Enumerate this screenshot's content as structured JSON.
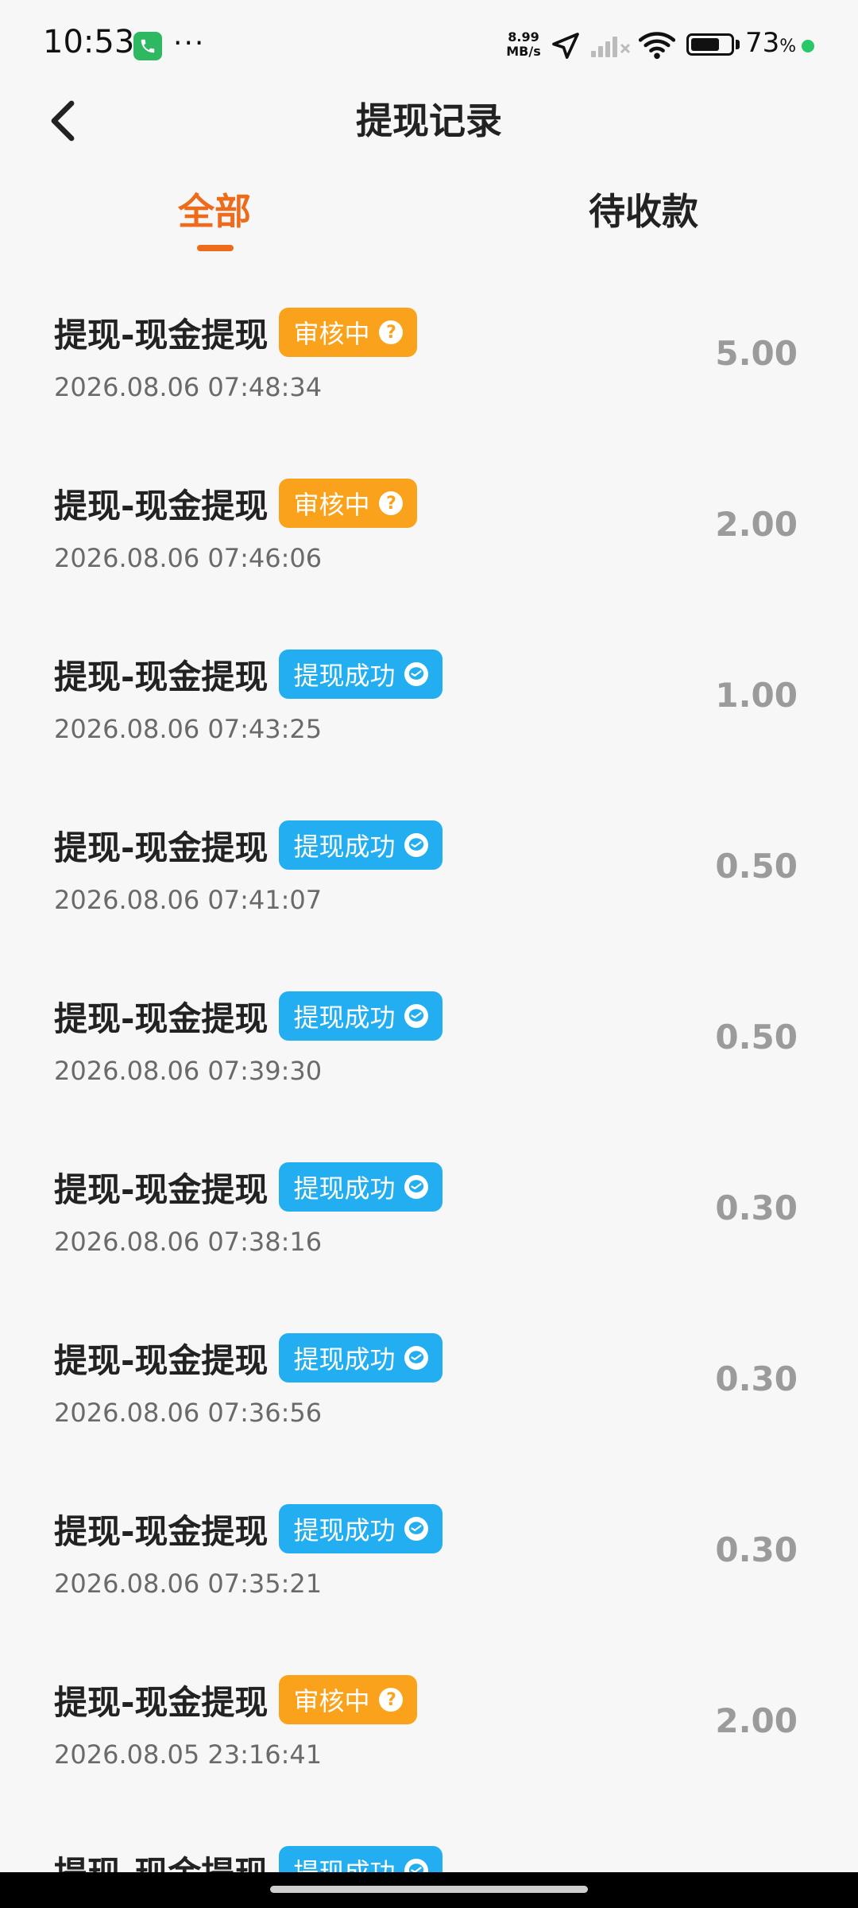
{
  "status_bar": {
    "time": "10:53",
    "dots": "···",
    "speed_value": "8.99",
    "speed_unit": "MB/s",
    "battery_level": 0.73,
    "battery_percent": "73",
    "percent_sign": "%",
    "colors": {
      "call": "#2eb862",
      "dot": "#29c765"
    }
  },
  "header": {
    "title": "提现记录",
    "back_icon": "chevron-left-icon"
  },
  "tabs": [
    {
      "label": "全部",
      "active": true
    },
    {
      "label": "待收款",
      "active": false
    }
  ],
  "colors": {
    "accent": "#ee6b1b",
    "pending_badge": "#faa21b",
    "success_badge": "#22aef0",
    "amount": "#9b9b9b"
  },
  "records": [
    {
      "title": "提现-现金提现",
      "status": "审核中",
      "status_type": "pending",
      "status_icon": "question-circle-icon",
      "time": "2026.08.06 07:48:34",
      "amount": "5.00"
    },
    {
      "title": "提现-现金提现",
      "status": "审核中",
      "status_type": "pending",
      "status_icon": "question-circle-icon",
      "time": "2026.08.06 07:46:06",
      "amount": "2.00"
    },
    {
      "title": "提现-现金提现",
      "status": "提现成功",
      "status_type": "success",
      "status_icon": "wechat-icon",
      "time": "2026.08.06 07:43:25",
      "amount": "1.00"
    },
    {
      "title": "提现-现金提现",
      "status": "提现成功",
      "status_type": "success",
      "status_icon": "wechat-icon",
      "time": "2026.08.06 07:41:07",
      "amount": "0.50"
    },
    {
      "title": "提现-现金提现",
      "status": "提现成功",
      "status_type": "success",
      "status_icon": "wechat-icon",
      "time": "2026.08.06 07:39:30",
      "amount": "0.50"
    },
    {
      "title": "提现-现金提现",
      "status": "提现成功",
      "status_type": "success",
      "status_icon": "wechat-icon",
      "time": "2026.08.06 07:38:16",
      "amount": "0.30"
    },
    {
      "title": "提现-现金提现",
      "status": "提现成功",
      "status_type": "success",
      "status_icon": "wechat-icon",
      "time": "2026.08.06 07:36:56",
      "amount": "0.30"
    },
    {
      "title": "提现-现金提现",
      "status": "提现成功",
      "status_type": "success",
      "status_icon": "wechat-icon",
      "time": "2026.08.06 07:35:21",
      "amount": "0.30"
    },
    {
      "title": "提现-现金提现",
      "status": "审核中",
      "status_type": "pending",
      "status_icon": "question-circle-icon",
      "time": "2026.08.05 23:16:41",
      "amount": "2.00"
    },
    {
      "title": "提现-现金提现",
      "status": "提现成功",
      "status_type": "success",
      "status_icon": "wechat-icon",
      "time": "",
      "amount": ""
    }
  ]
}
